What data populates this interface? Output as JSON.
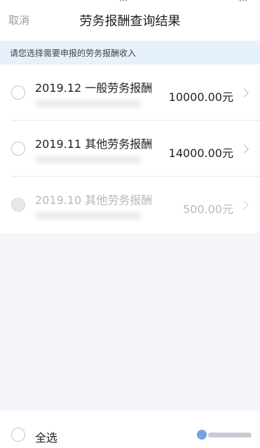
{
  "status_bar": {
    "carrier": "...",
    "battery": "..."
  },
  "header": {
    "cancel": "取消",
    "title": "劳务报酬查询结果"
  },
  "hint": "请您选择需要申报的劳务报酬收入",
  "records": [
    {
      "title": "2019.12 一般劳务报酬",
      "amount": "10000.00元",
      "enabled": true
    },
    {
      "title": "2019.11 其他劳务报酬",
      "amount": "14000.00元",
      "enabled": true
    },
    {
      "title": "2019.10 其他劳务报酬",
      "amount": "500.00元",
      "enabled": false
    }
  ],
  "footer": {
    "select_all": "全选"
  },
  "colors": {
    "background": "#f4f5f9",
    "hint_background": "#e6f1fb",
    "disabled_text": "#b8b8b8"
  },
  "icons": [
    "radio-icon",
    "chevron-right-icon",
    "watermark-logo"
  ]
}
